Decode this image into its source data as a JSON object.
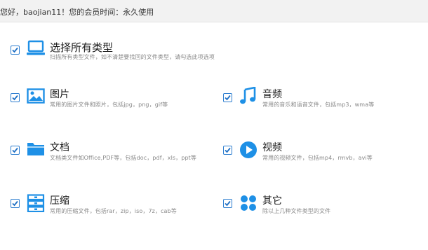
{
  "header": {
    "greeting": "您好，baojian11！您的会员时间：永久使用"
  },
  "options": [
    {
      "key": "all",
      "title": "选择所有类型",
      "desc": "扫描所有类型文件，如不清楚要找回的文件类型，请勾选此项选项",
      "checked": true,
      "icon": "monitor-icon"
    },
    {
      "key": "image",
      "title": "图片",
      "desc": "常用的图片文件和照片，包括jpg，png，gif等",
      "checked": true,
      "icon": "image-icon"
    },
    {
      "key": "audio",
      "title": "音频",
      "desc": "常用的音乐和语音文件，包括mp3，wma等",
      "checked": true,
      "icon": "music-note-icon"
    },
    {
      "key": "document",
      "title": "文档",
      "desc": "文档类文件如Office,PDF等，包括doc，pdf，xls，ppt等",
      "checked": true,
      "icon": "folder-icon"
    },
    {
      "key": "video",
      "title": "视频",
      "desc": "常用的视频文件，包括mp4，rmvb，avi等",
      "checked": true,
      "icon": "play-icon"
    },
    {
      "key": "archive",
      "title": "压缩",
      "desc": "常用的压缩文件，包括rar，zip，iso，7z，cab等",
      "checked": true,
      "icon": "archive-icon"
    },
    {
      "key": "other",
      "title": "其它",
      "desc": "除以上几种文件类型的文件",
      "checked": true,
      "icon": "grid-icon"
    }
  ],
  "colors": {
    "accent": "#1e90e6",
    "checkbox_border": "#2f7fd0"
  }
}
